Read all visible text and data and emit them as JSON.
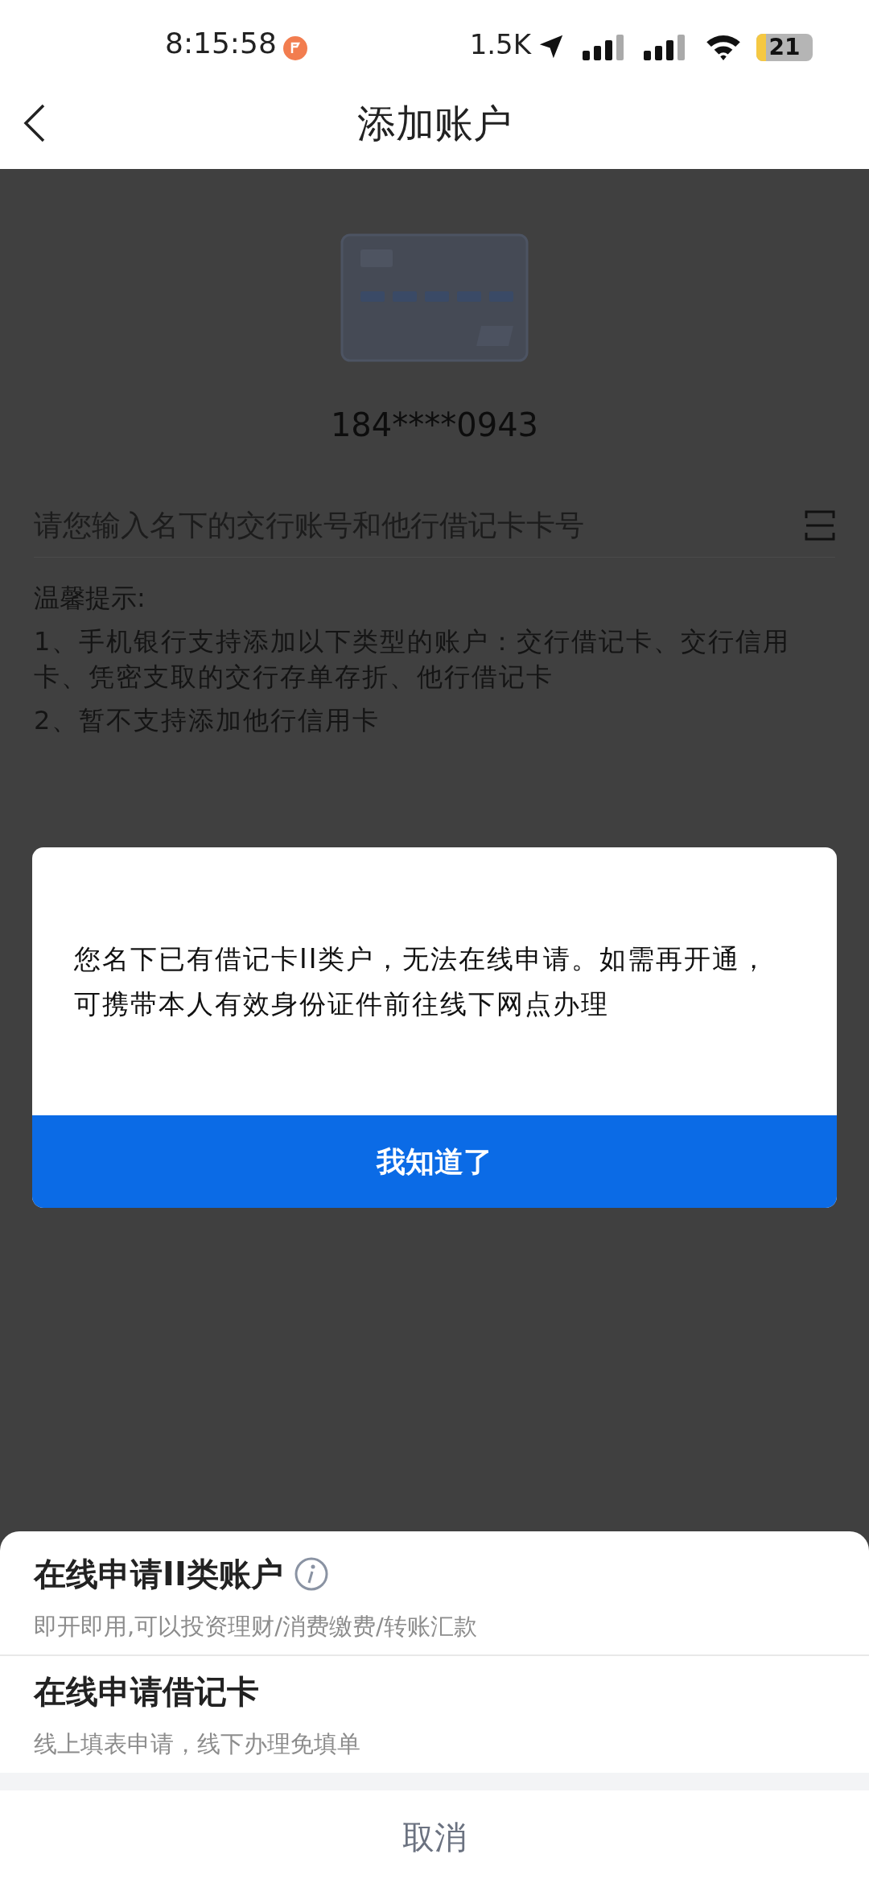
{
  "status_bar": {
    "time": "8:15:58",
    "speed": "1.5K",
    "battery": "21"
  },
  "nav": {
    "title": "添加账户"
  },
  "account": {
    "number": "184****0943"
  },
  "input": {
    "placeholder": "请您输入名下的交行账号和他行借记卡卡号"
  },
  "tips": {
    "title": "温馨提示:",
    "lines": [
      "1、手机银行支持添加以下类型的账户：交行借记卡、交行信用卡、凭密支取的交行存单存折、他行借记卡",
      "2、暂不支持添加他行信用卡"
    ]
  },
  "dialog": {
    "message": "您名下已有借记卡II类户，无法在线申请。如需再开通，可携带本人有效身份证件前往线下网点办理",
    "button": "我知道了"
  },
  "sheet": {
    "options": [
      {
        "title": "在线申请II类账户",
        "subtitle": "即开即用,可以投资理财/消费缴费/转账汇款",
        "info": true
      },
      {
        "title": "在线申请借记卡",
        "subtitle": "线上填表申请，线下办理免填单",
        "info": false
      }
    ],
    "cancel": "取消"
  }
}
